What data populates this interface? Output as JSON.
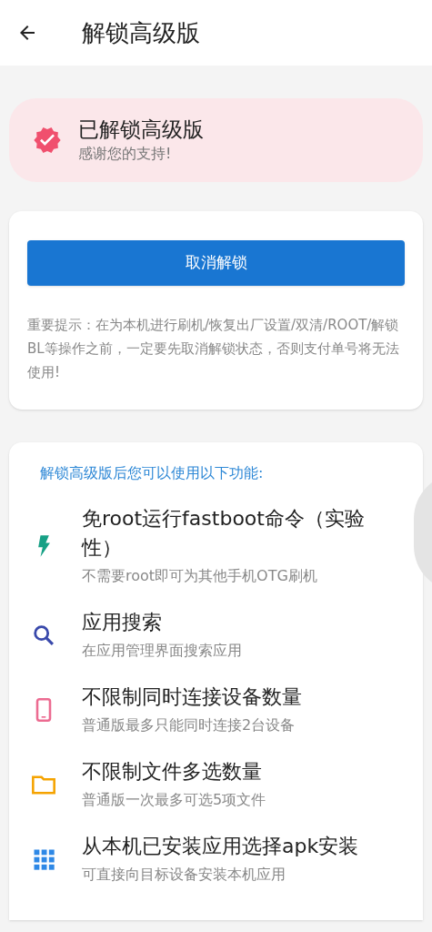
{
  "app_bar": {
    "title": "解锁高级版"
  },
  "status_card": {
    "title": "已解锁高级版",
    "subtitle": "感谢您的支持!"
  },
  "unlock_card": {
    "button": "取消解锁",
    "note": "重要提示：在为本机进行刷机/恢复出厂设置/双清/ROOT/解锁BL等操作之前，一定要先取消解锁状态，否则支付单号将无法使用!"
  },
  "features": {
    "heading": "解锁高级版后您可以使用以下功能:",
    "items": [
      {
        "kind": "bolt",
        "title": "免root运行fastboot命令（实验性）",
        "subtitle": "不需要root即可为其他手机OTG刷机"
      },
      {
        "kind": "search",
        "title": "应用搜索",
        "subtitle": "在应用管理界面搜索应用"
      },
      {
        "kind": "phone",
        "title": "不限制同时连接设备数量",
        "subtitle": "普通版最多只能同时连接2台设备"
      },
      {
        "kind": "folder",
        "title": "不限制文件多选数量",
        "subtitle": "普通版一次最多可选5项文件"
      },
      {
        "kind": "grid",
        "title": "从本机已安装应用选择apk安装",
        "subtitle": "可直接向目标设备安装本机应用"
      }
    ]
  }
}
